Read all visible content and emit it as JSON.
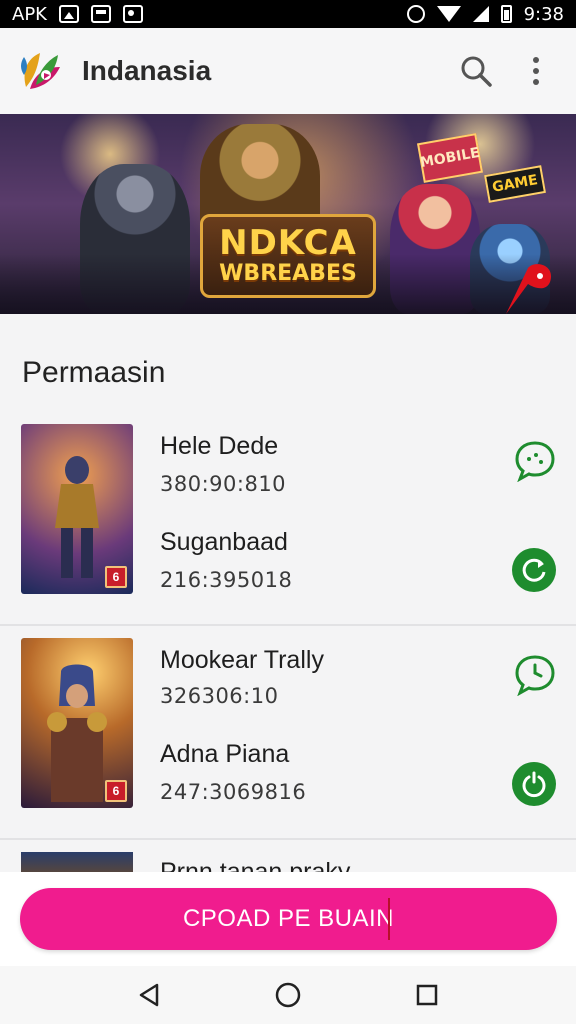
{
  "status_bar": {
    "carrier": "APK",
    "time": "9:38",
    "icons": [
      "photo-icon",
      "file-icon",
      "image-icon",
      "alarm-icon",
      "wifi-icon",
      "signal-icon",
      "battery-icon"
    ]
  },
  "app_bar": {
    "title": "Indanasia",
    "logo": "leaf-logo",
    "actions": [
      "search-icon",
      "more-vert-icon"
    ]
  },
  "banner": {
    "title_line1": "NDKCA",
    "title_line2": "WBREABES",
    "sign_1": "MOBILE",
    "sign_2": "GAME"
  },
  "section": {
    "title": "Permaasin"
  },
  "cards": [
    {
      "rows": [
        {
          "name": "Hele Dede",
          "number": "380:90:810",
          "action_icon": "chat-bubble-icon"
        },
        {
          "name": "Suganbaad",
          "number": "216:395018",
          "action_icon": "refresh-icon"
        }
      ],
      "badge": "6"
    },
    {
      "rows": [
        {
          "name": "Mookear Trally",
          "number": "326306:10",
          "action_icon": "chat-clock-icon"
        },
        {
          "name": "Adna Piana",
          "number": "247:3069816",
          "action_icon": "power-icon"
        }
      ],
      "badge": "6"
    }
  ],
  "partial_card": {
    "text": "Prnn tanan praky"
  },
  "cta": {
    "label": "CPOAD PE BUAIN"
  },
  "colors": {
    "accent": "#f01c8e",
    "action_green": "#1e8c2e"
  },
  "nav_bar": [
    "back-icon",
    "home-icon",
    "recents-icon"
  ]
}
